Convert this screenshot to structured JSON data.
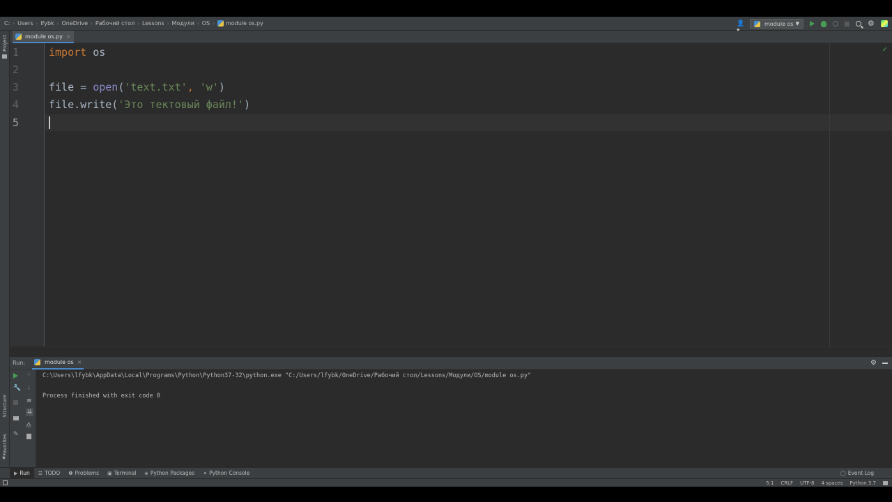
{
  "breadcrumbs": [
    "C:",
    "Users",
    "lfybk",
    "OneDrive",
    "Рабочий стол",
    "Lessons",
    "Модули",
    "OS",
    "module os.py"
  ],
  "run_config": {
    "name": "module os"
  },
  "left_strip": {
    "project_label": "Project",
    "structure_label": "Structure",
    "favorites_label": "Favorites"
  },
  "tabs": [
    {
      "label": "module os.py",
      "close": "×"
    }
  ],
  "editor": {
    "line_numbers": [
      "1",
      "2",
      "3",
      "4",
      "5"
    ],
    "current_line": 5,
    "code": {
      "line1_kw": "import",
      "line1_rest": " os",
      "line3_a": "file = ",
      "line3_fn": "open",
      "line3_b": "(",
      "line3_s1": "'text.txt'",
      "line3_c": ", ",
      "line3_s2": "'w'",
      "line3_d": ")",
      "line4_a": "file.write(",
      "line4_s": "'Это тектовый файл!'",
      "line4_b": ")"
    }
  },
  "run_panel": {
    "label": "Run:",
    "tab_label": "module os",
    "output": [
      "C:\\Users\\lfybk\\AppData\\Local\\Programs\\Python\\Python37-32\\python.exe \"C:/Users/lfybk/OneDrive/Рабочий стол/Lessons/Модули/OS/module os.py\"",
      "",
      "Process finished with exit code 0"
    ]
  },
  "tool_windows": [
    {
      "label": "Run",
      "icon": "play-icon"
    },
    {
      "label": "TODO",
      "icon": "list-icon"
    },
    {
      "label": "Problems",
      "icon": "info-icon"
    },
    {
      "label": "Terminal",
      "icon": "terminal-icon"
    },
    {
      "label": "Python Packages",
      "icon": "packages-icon"
    },
    {
      "label": "Python Console",
      "icon": "python-icon"
    }
  ],
  "event_log": "Event Log",
  "status": {
    "position": "5:1",
    "line_sep": "CRLF",
    "encoding": "UTF-8",
    "indent": "4 spaces",
    "interpreter": "Python 3.7"
  },
  "colors": {
    "keyword": "#cc7832",
    "builtin": "#8888c6",
    "string": "#6a8759",
    "run_green": "#499c54",
    "accent": "#4a88c7"
  }
}
